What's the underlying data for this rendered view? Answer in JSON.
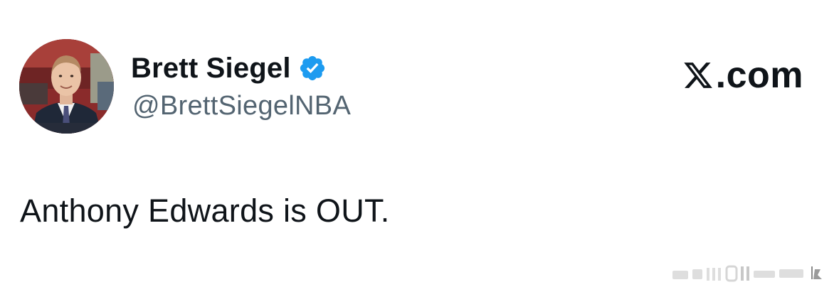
{
  "author": {
    "display_name": "Brett Siegel",
    "handle": "@BrettSiegelNBA",
    "verified": true,
    "verified_color": "#1d9bf0",
    "avatar_icon": "profile-photo"
  },
  "site": {
    "domain": ".com",
    "logo_icon": "x-logo-icon"
  },
  "tweet": {
    "text": "Anthony Edwards is OUT."
  },
  "colors": {
    "text_primary": "#0f1419",
    "text_secondary": "#536471",
    "background": "#ffffff"
  }
}
